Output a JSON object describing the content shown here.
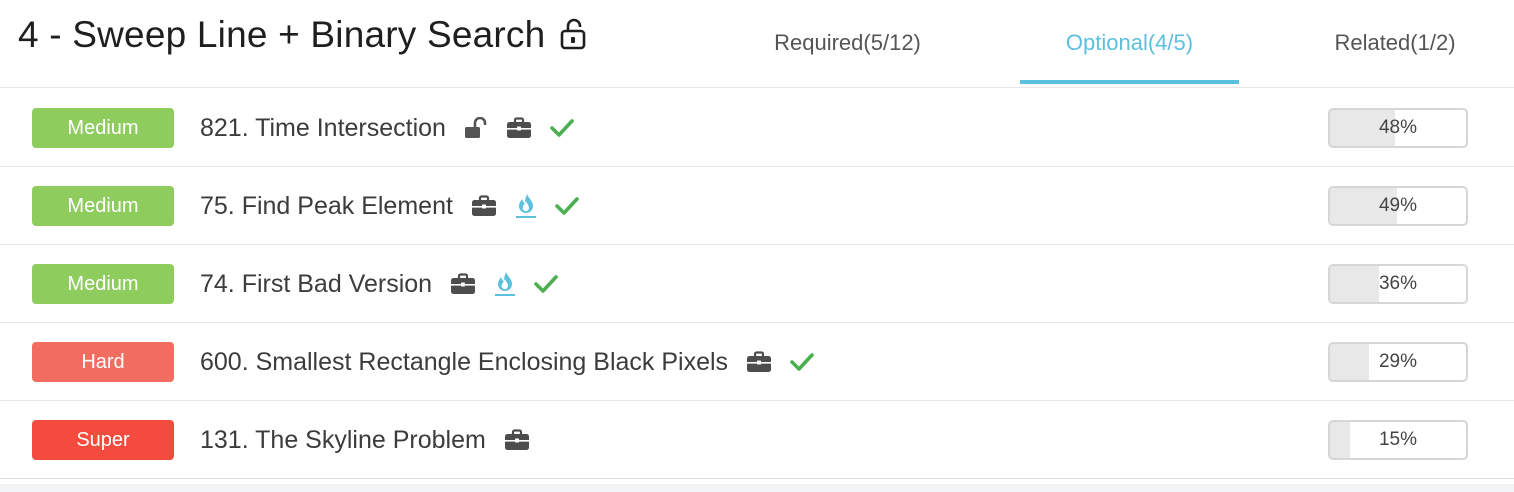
{
  "header": {
    "title": "4 - Sweep Line + Binary Search",
    "title_icon": "unlock-icon",
    "tabs": [
      {
        "label": "Required(5/12)",
        "active": false
      },
      {
        "label": "Optional(4/5)",
        "active": true
      },
      {
        "label": "Related(1/2)",
        "active": false
      }
    ]
  },
  "colors": {
    "accent": "#5bc0de",
    "medium": "#8ecc5e",
    "hard": "#f36c60",
    "super": "#f44b3f",
    "check": "#4caf50"
  },
  "problems": [
    {
      "difficulty": "Medium",
      "title": "821. Time Intersection",
      "icons": [
        "unlock-icon",
        "briefcase-icon",
        "check-icon"
      ],
      "percent": 48,
      "percent_label": "48%"
    },
    {
      "difficulty": "Medium",
      "title": "75. Find Peak Element",
      "icons": [
        "briefcase-icon",
        "flame-icon",
        "check-icon"
      ],
      "percent": 49,
      "percent_label": "49%"
    },
    {
      "difficulty": "Medium",
      "title": "74. First Bad Version",
      "icons": [
        "briefcase-icon",
        "flame-icon",
        "check-icon"
      ],
      "percent": 36,
      "percent_label": "36%"
    },
    {
      "difficulty": "Hard",
      "title": "600. Smallest Rectangle Enclosing Black Pixels",
      "icons": [
        "briefcase-icon",
        "check-icon"
      ],
      "percent": 29,
      "percent_label": "29%"
    },
    {
      "difficulty": "Super",
      "title": "131. The Skyline Problem",
      "icons": [
        "briefcase-icon"
      ],
      "percent": 15,
      "percent_label": "15%"
    }
  ]
}
